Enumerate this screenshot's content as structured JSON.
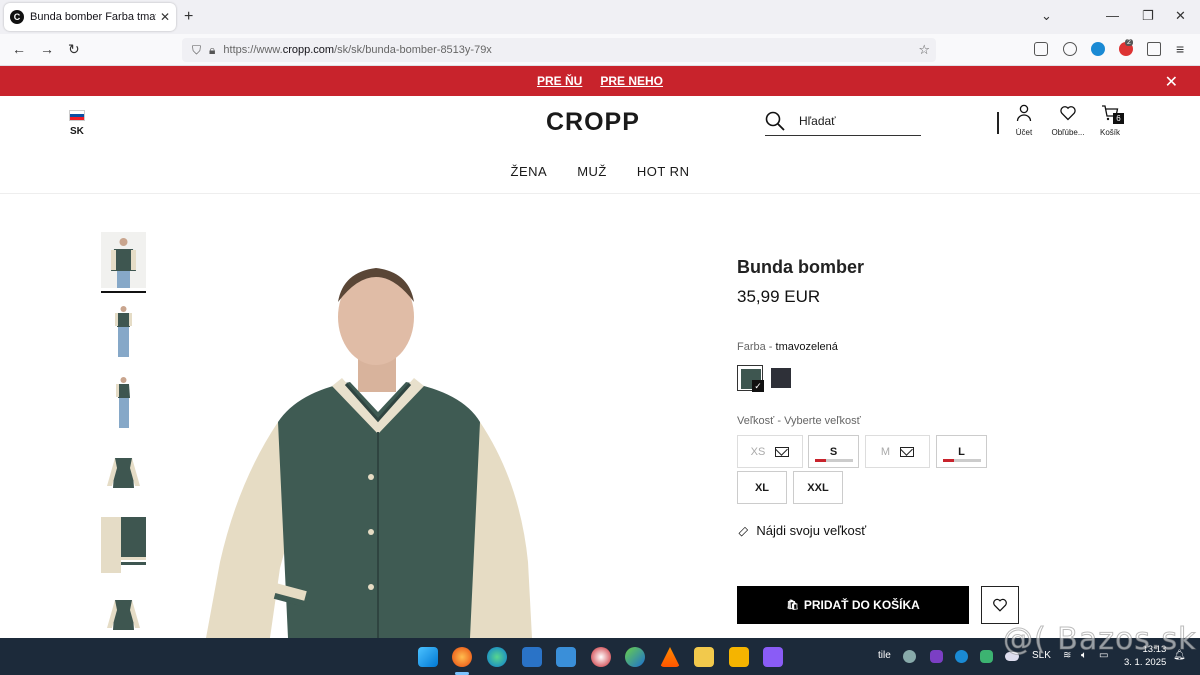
{
  "browser": {
    "tab_title": "Bunda bomber Farba tmavozelená",
    "tab_favicon": "C",
    "new_tab": "+",
    "url_prefix": "https://www.",
    "url_domain": "cropp.com",
    "url_path": "/sk/sk/bunda-bomber-8513y-79x",
    "ext_badge": "2"
  },
  "promo": {
    "links": [
      "PRE ŇU",
      "PRE NEHO"
    ],
    "close": "✕",
    "bg_color": "#c8232c"
  },
  "header": {
    "country": "SK",
    "logo": "CROPP",
    "search_placeholder": "Hľadať",
    "account_label": "Účet",
    "favorites_label": "Obľúbe...",
    "cart_label": "Košík",
    "cart_count": "6",
    "nav": [
      "ŽENA",
      "MUŽ",
      "HOT RN"
    ]
  },
  "product": {
    "title": "Bunda bomber",
    "price": "35,99 EUR",
    "color_label": "Farba - ",
    "color_value": "tmavozelená",
    "colors": [
      {
        "name": "tmavozelená",
        "hex": "#3e5650",
        "selected": true
      },
      {
        "name": "tmavá",
        "hex": "#2e3038",
        "selected": false
      }
    ],
    "size_label": "Veľkosť - Vyberte veľkosť",
    "sizes": [
      {
        "label": "XS",
        "available": false,
        "low_stock_fraction": null
      },
      {
        "label": "S",
        "available": true,
        "low_stock_fraction": 0.3
      },
      {
        "label": "M",
        "available": false,
        "low_stock_fraction": null
      },
      {
        "label": "L",
        "available": true,
        "low_stock_fraction": 0.3
      },
      {
        "label": "XL",
        "available": true,
        "low_stock_fraction": null
      },
      {
        "label": "XXL",
        "available": true,
        "low_stock_fraction": null
      }
    ],
    "fit_label": "Nájdi svoju veľkosť",
    "add_to_cart": "PRIDAŤ DO KOŠÍKA"
  },
  "taskbar": {
    "tray_text": "tile",
    "language": "SLK",
    "time": "13:13",
    "date": "3. 1. 2025"
  },
  "watermark": "@( Bazos.sk"
}
